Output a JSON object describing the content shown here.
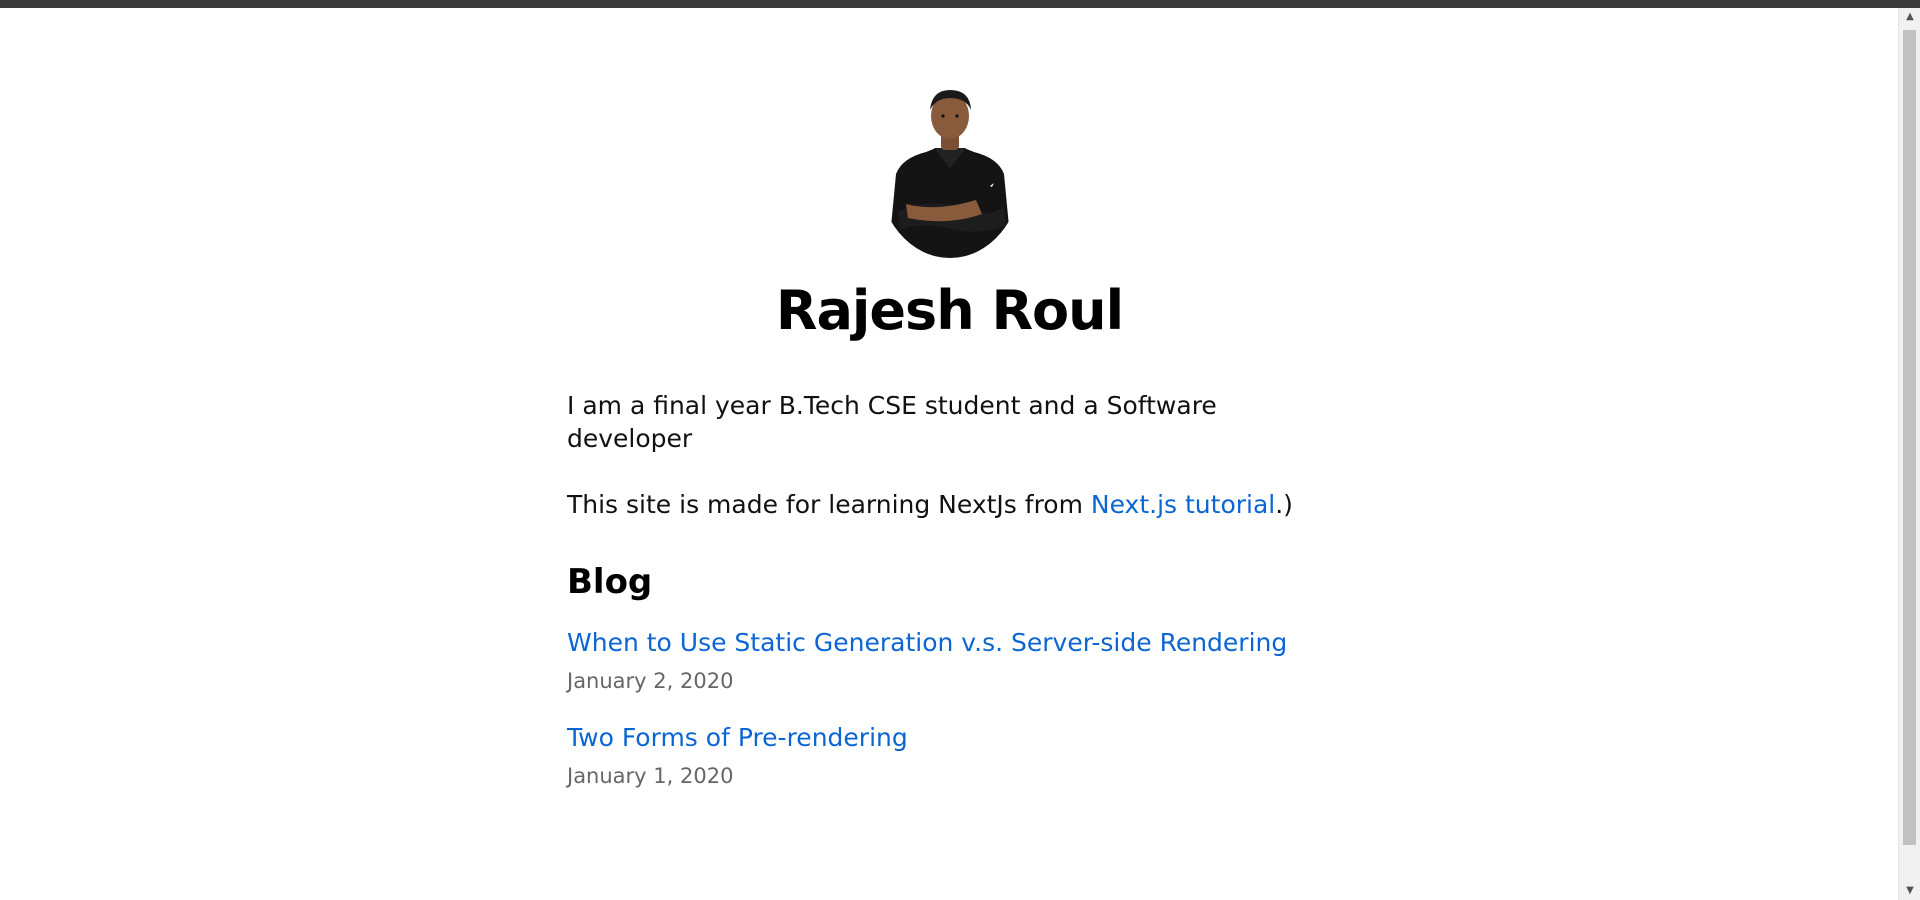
{
  "profile": {
    "name": "Rajesh Roul",
    "avatar_alt": "Rajesh Roul"
  },
  "intro": {
    "line1": "I am a final year B.Tech CSE student and a Software developer",
    "line2_prefix": "This site is made for learning NextJs from ",
    "line2_link": "Next.js tutorial",
    "line2_suffix": ".)"
  },
  "blog": {
    "title": "Blog",
    "posts": [
      {
        "title": "When to Use Static Generation v.s. Server-side Rendering",
        "date": "January 2, 2020"
      },
      {
        "title": "Two Forms of Pre-rendering",
        "date": "January 1, 2020"
      }
    ]
  },
  "colors": {
    "link": "#0b66d4",
    "date": "#666666",
    "heading": "#000000",
    "topbar": "#3a3a3a",
    "scrollbar_thumb": "#c1c1c1"
  },
  "icons": {
    "scroll_up": "triangle-up-icon",
    "scroll_down": "triangle-down-icon"
  },
  "scroll": {
    "visible_fraction": 0.94,
    "position_fraction": 0
  }
}
